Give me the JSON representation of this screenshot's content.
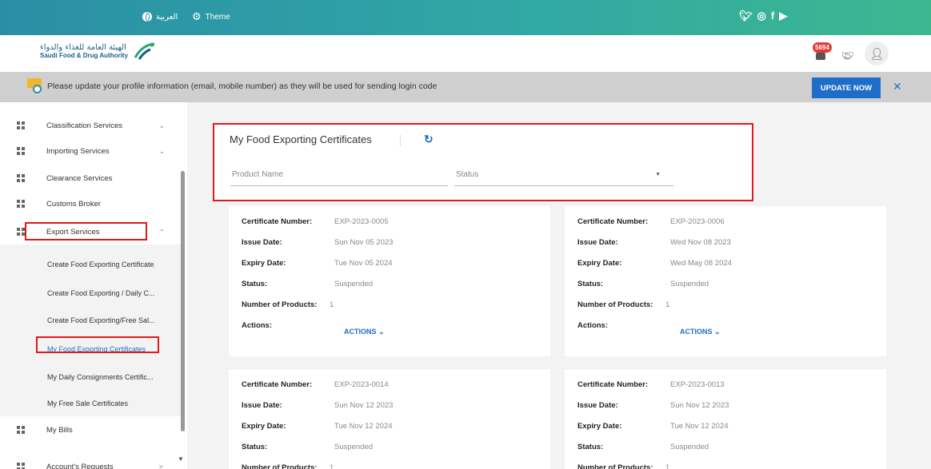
{
  "topbar": {
    "language_label": "العربية",
    "theme_label": "Theme",
    "social_icons": [
      "twitter-icon",
      "instagram-icon",
      "facebook-icon",
      "youtube-icon"
    ]
  },
  "header": {
    "logo_arabic": "الهيئة العامة للغذاء والدواء",
    "logo_english": "Saudi Food & Drug Authority",
    "notification_count": "5694"
  },
  "notice": {
    "message": "Please update your profile information (email, mobile number) as they will be used for sending login code",
    "update_button": "UPDATE NOW",
    "close_glyph": "✕"
  },
  "sidebar": {
    "items": [
      {
        "label": "Classification Services",
        "chevron": "⌄"
      },
      {
        "label": "Importing Services",
        "chevron": "⌄"
      },
      {
        "label": "Clearance Services",
        "chevron": ""
      },
      {
        "label": "Customs Broker",
        "chevron": ""
      },
      {
        "label": "Export Services",
        "chevron": "⌃"
      },
      {
        "label": "My Bills",
        "chevron": ""
      },
      {
        "label": "Account's Requests",
        "chevron": ">"
      }
    ],
    "sub_items": [
      "Create Food Exporting Certificate",
      "Create Food Exporting / Daily C...",
      "Create Food Exporting/Free Sal...",
      "My Food Exporting Certificates",
      "My Daily Consignments Certific...",
      "My Free Sale Certificates"
    ]
  },
  "main": {
    "title": "My Food Exporting Certificates",
    "product_name_placeholder": "Product Name",
    "status_placeholder": "Status",
    "labels": {
      "certificate_number": "Certificate Number:",
      "issue_date": "Issue Date:",
      "expiry_date": "Expiry Date:",
      "status": "Status:",
      "number_of_products": "Number of Products:",
      "actions": "Actions:"
    },
    "actions_button": "ACTIONS ⌄",
    "cards": [
      {
        "certificate_number": "EXP-2023-0005",
        "issue_date": "Sun Nov 05 2023",
        "expiry_date": "Tue Nov 05 2024",
        "status": "Suspended",
        "number_of_products": "1"
      },
      {
        "certificate_number": "EXP-2023-0006",
        "issue_date": "Wed Nov 08 2023",
        "expiry_date": "Wed May 08 2024",
        "status": "Suspended",
        "number_of_products": "1"
      },
      {
        "certificate_number": "EXP-2023-0014",
        "issue_date": "Sun Nov 12 2023",
        "expiry_date": "Tue Nov 12 2024",
        "status": "Suspended",
        "number_of_products": "1"
      },
      {
        "certificate_number": "EXP-2023-0013",
        "issue_date": "Sun Nov 12 2023",
        "expiry_date": "Tue Nov 12 2024",
        "status": "Suspended",
        "number_of_products": "1"
      }
    ]
  },
  "colors": {
    "topbar_start": "#2a8fa5",
    "topbar_end": "#3cb88f",
    "accent": "#1e6dc9",
    "highlight_border": "#e0191c",
    "badge": "#e53935"
  }
}
